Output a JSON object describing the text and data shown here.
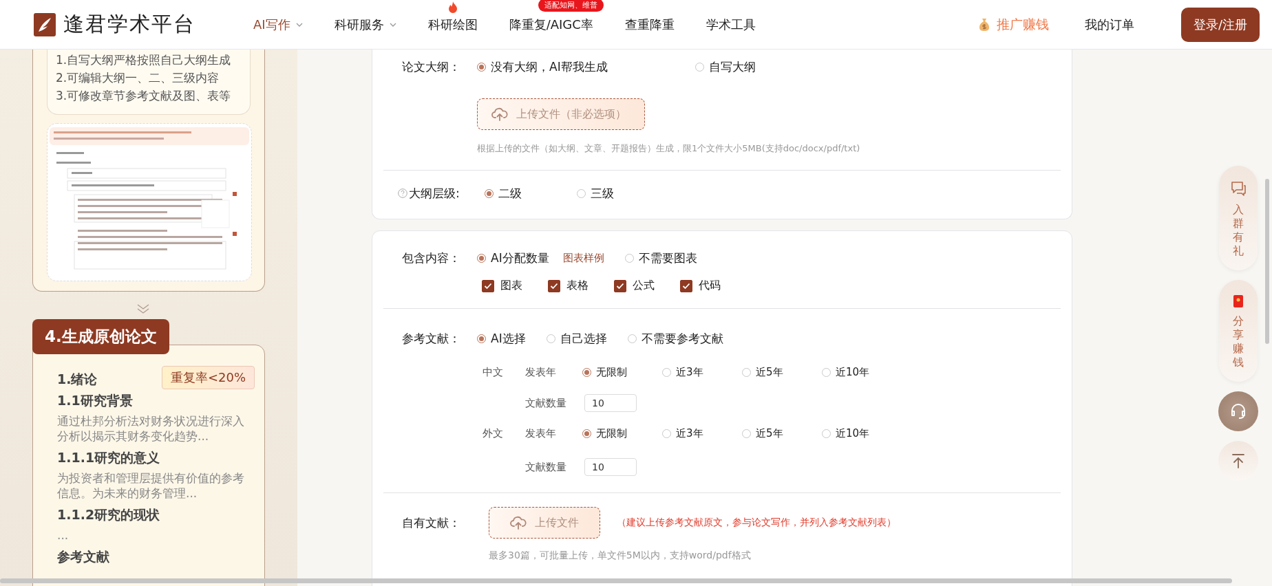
{
  "header": {
    "logo_text": "逢君学术平台",
    "nav": [
      {
        "label": "AI写作",
        "selected": true,
        "dropdown": true,
        "hot": false
      },
      {
        "label": "科研服务",
        "selected": false,
        "dropdown": true,
        "hot": false
      },
      {
        "label": "科研绘图",
        "selected": false,
        "dropdown": false,
        "hot": true
      },
      {
        "label": "降重复/AIGC率",
        "selected": false,
        "dropdown": false,
        "hot": false,
        "badge": "适配知网、维普"
      },
      {
        "label": "查重降重",
        "selected": false,
        "dropdown": false,
        "hot": false
      },
      {
        "label": "学术工具",
        "selected": false,
        "dropdown": false,
        "hot": false
      }
    ],
    "promo": "推广赚钱",
    "orders": "我的订单",
    "login_button": "登录/注册"
  },
  "steps": {
    "outline_features": [
      "1.自写大纲严格按照自己大纲生成",
      "2.可编辑大纲一、二、三级内容",
      "3.可修改章节参考文献及图、表等"
    ],
    "preview": {
      "kind": "picture"
    },
    "step4": {
      "title": "4.生成原创论文",
      "badge": "重复率<20%",
      "outline": [
        {
          "kind": "heading",
          "text": "1.绪论"
        },
        {
          "kind": "heading",
          "text": "1.1研究背景"
        },
        {
          "kind": "summary",
          "text": "通过杜邦分析法对财务状况进行深入分析以揭示其财务变化趋势..."
        },
        {
          "kind": "heading",
          "text": "1.1.1研究的意义"
        },
        {
          "kind": "summary",
          "text": "为投资者和管理层提供有价值的参考信息。为未来的财务管理..."
        },
        {
          "kind": "heading",
          "text": "1.1.2研究的现状"
        },
        {
          "kind": "summary",
          "text": "..."
        },
        {
          "kind": "heading",
          "text": "参考文献"
        }
      ]
    }
  },
  "outline_section": {
    "outline": {
      "label": "论文大纲：",
      "options": [
        {
          "label": "没有大纲，AI帮我生成",
          "selected": true
        },
        {
          "label": "自写大纲",
          "selected": false
        }
      ],
      "upload": "上传文件（非必选项）",
      "hint": "根据上传的文件（如大纲、文章、开题报告）生成，限1个文件大小5MB(支持doc/docx/pdf/txt)"
    },
    "level": {
      "label": "大纲层级:",
      "options": [
        {
          "label": "二级",
          "selected": true
        },
        {
          "label": "三级",
          "selected": false
        }
      ]
    }
  },
  "content_section": {
    "contents": {
      "label": "包含内容：",
      "options": [
        {
          "label": "AI分配数量",
          "selected": true
        },
        {
          "label": "不需要图表",
          "selected": false
        }
      ],
      "sample_link": "图表样例",
      "checks": [
        {
          "label": "图表",
          "checked": true
        },
        {
          "label": "表格",
          "checked": true
        },
        {
          "label": "公式",
          "checked": true
        },
        {
          "label": "代码",
          "checked": true
        }
      ]
    },
    "references": {
      "label": "参考文献：",
      "options": [
        {
          "label": "AI选择",
          "selected": true
        },
        {
          "label": "自己选择",
          "selected": false
        },
        {
          "label": "不需要参考文献",
          "selected": false
        }
      ],
      "groups": [
        {
          "language": "中文",
          "year_label": "发表年",
          "years": [
            {
              "label": "无限制",
              "selected": true
            },
            {
              "label": "近3年",
              "selected": false
            },
            {
              "label": "近5年",
              "selected": false
            },
            {
              "label": "近10年",
              "selected": false
            }
          ],
          "count_label": "文献数量",
          "count": "10"
        },
        {
          "language": "外文",
          "year_label": "发表年",
          "years": [
            {
              "label": "无限制",
              "selected": true
            },
            {
              "label": "近3年",
              "selected": false
            },
            {
              "label": "近5年",
              "selected": false
            },
            {
              "label": "近10年",
              "selected": false
            }
          ],
          "count_label": "文献数量",
          "count": "10"
        }
      ]
    },
    "own_refs": {
      "label": "自有文献：",
      "upload": "上传文件",
      "note": "（建议上传参考文献原文，参与论文写作，并列入参考文献列表）",
      "hint": "最多30篇，可批量上传，单文件5M以内，支持word/pdf格式"
    }
  },
  "side_buttons": [
    {
      "kind": "group",
      "label": "入群有礼"
    },
    {
      "kind": "share",
      "label": "分享赚钱"
    },
    {
      "kind": "service"
    },
    {
      "kind": "top"
    }
  ]
}
